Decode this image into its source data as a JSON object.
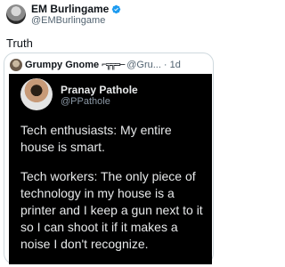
{
  "tweet": {
    "author_name": "EM Burlingame",
    "author_handle": "@EMBurlingame",
    "text": "Truth",
    "verified_color": "#1d9bf0"
  },
  "quote": {
    "author_name": "Grumpy Gnome",
    "emoji": "⌐╦╦═─",
    "author_handle": "@Gru...",
    "separator": "·",
    "time": "1d",
    "embedded_tweet": {
      "author_name": "Pranay Pathole",
      "author_handle": "@PPathole",
      "paragraph_1": "Tech enthusiasts: My entire house is smart.",
      "paragraph_2": "Tech workers: The only piece of technology in my house is a printer and I keep a gun next to it so I can shoot it if it makes a noise I don't recognize."
    }
  }
}
